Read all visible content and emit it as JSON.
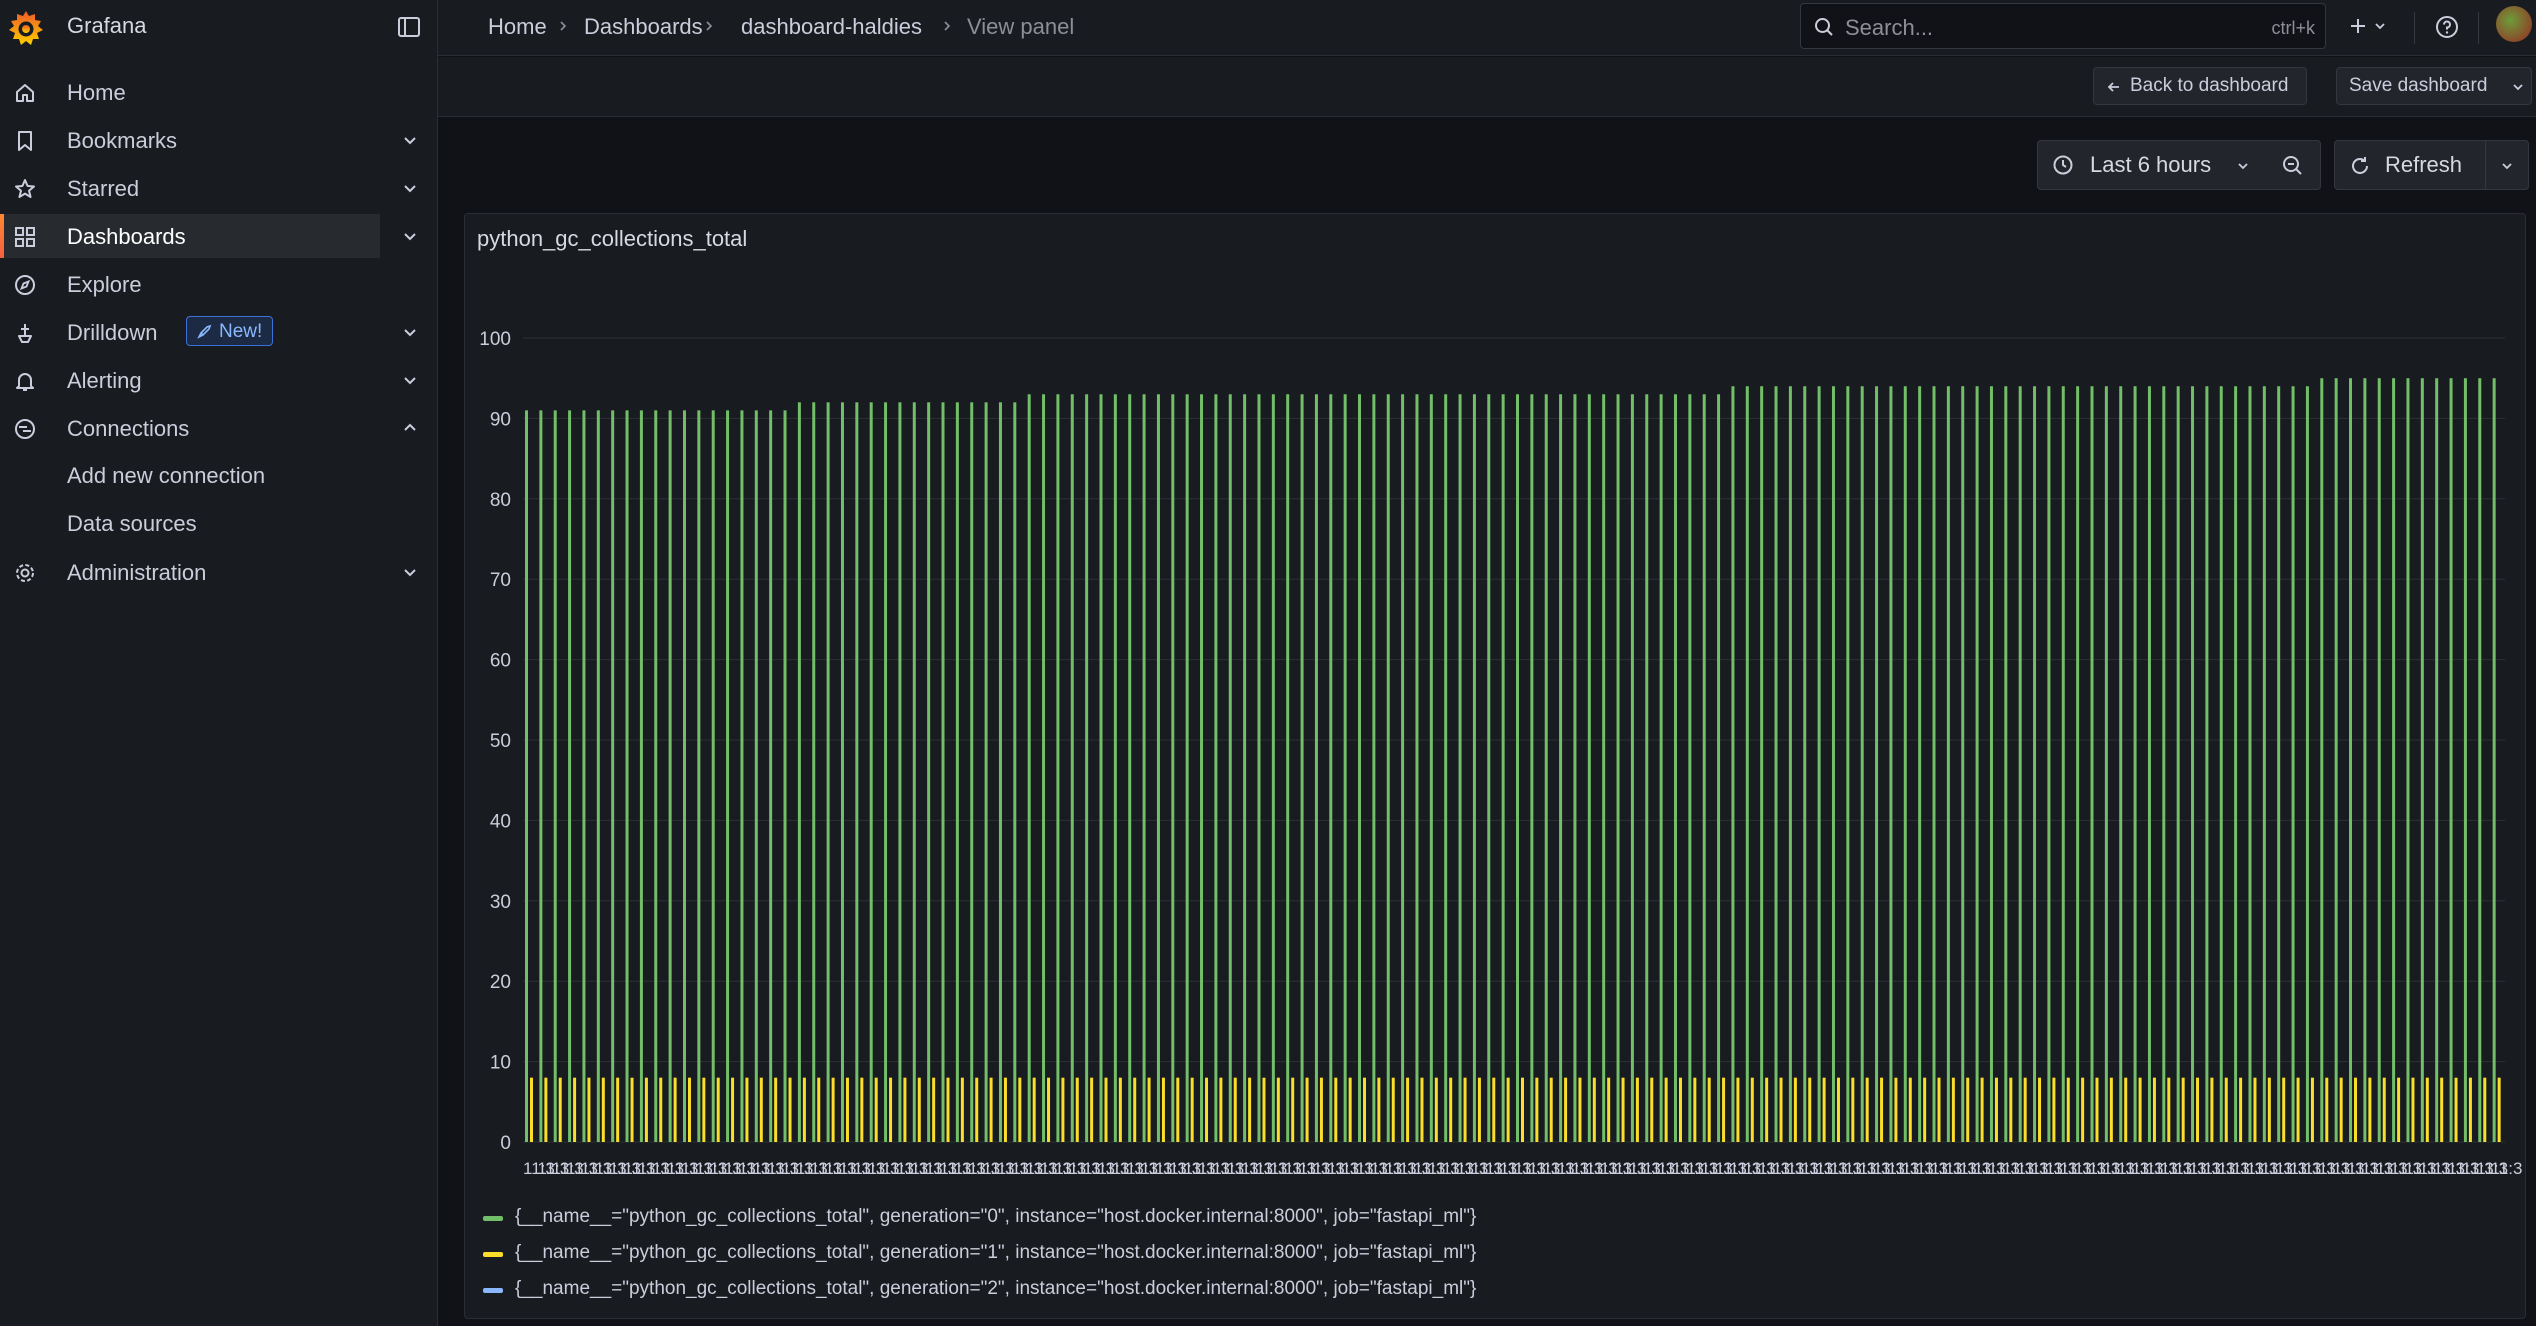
{
  "app": {
    "name": "Grafana"
  },
  "sidebar": {
    "items": [
      {
        "label": "Home"
      },
      {
        "label": "Bookmarks"
      },
      {
        "label": "Starred"
      },
      {
        "label": "Dashboards"
      },
      {
        "label": "Explore"
      },
      {
        "label": "Drilldown",
        "badge": "New!"
      },
      {
        "label": "Alerting"
      },
      {
        "label": "Connections",
        "children": [
          "Add new connection",
          "Data sources"
        ]
      },
      {
        "label": "Administration"
      }
    ]
  },
  "breadcrumb": [
    "Home",
    "Dashboards",
    "dashboard-haldies",
    "View panel"
  ],
  "search": {
    "placeholder": "Search...",
    "shortcut": "ctrl+k"
  },
  "actions": {
    "back": "Back to dashboard",
    "save": "Save dashboard"
  },
  "time": {
    "range": "Last 6 hours",
    "refresh": "Refresh"
  },
  "panel": {
    "title": "python_gc_collections_total"
  },
  "colors": {
    "gen0": "#73bf69",
    "gen1": "#fade2a",
    "gen2": "#8ab8ff",
    "accent": "#f55f3e"
  },
  "chart_data": {
    "type": "bar",
    "title": "python_gc_collections_total",
    "xlabel": "",
    "ylabel": "",
    "ylim": [
      0,
      100
    ],
    "yticks": [
      0,
      10,
      20,
      30,
      40,
      50,
      60,
      70,
      80,
      90,
      100
    ],
    "legend_position": "bottom",
    "grid": true,
    "x_tick_labels": "dense overlapping time labels",
    "series": [
      {
        "name": "{__name__=\"python_gc_collections_total\", generation=\"0\", instance=\"host.docker.internal:8000\", job=\"fastapi_ml\"}",
        "color": "#73bf69",
        "segments": [
          {
            "count": 19,
            "value": 91
          },
          {
            "count": 16,
            "value": 92
          },
          {
            "count": 49,
            "value": 93
          },
          {
            "count": 41,
            "value": 94
          },
          {
            "count": 13,
            "value": 95
          }
        ]
      },
      {
        "name": "{__name__=\"python_gc_collections_total\", generation=\"1\", instance=\"host.docker.internal:8000\", job=\"fastapi_ml\"}",
        "color": "#fade2a",
        "segments": [
          {
            "count": 138,
            "value": 8
          }
        ]
      },
      {
        "name": "{__name__=\"python_gc_collections_total\", generation=\"2\", instance=\"host.docker.internal:8000\", job=\"fastapi_ml\"}",
        "color": "#8ab8ff",
        "segments": [
          {
            "count": 138,
            "value": 0
          }
        ]
      }
    ]
  }
}
